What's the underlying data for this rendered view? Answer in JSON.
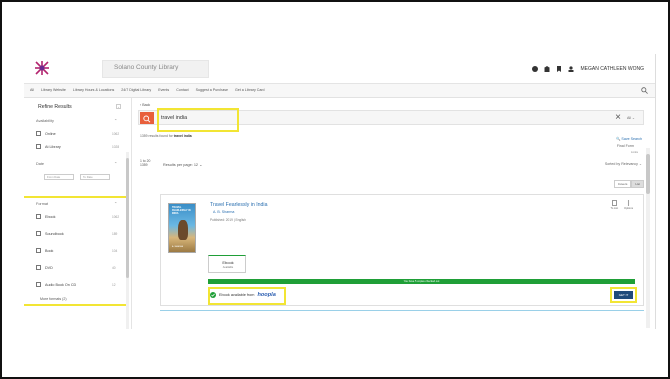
{
  "header": {
    "site_name": "Solano County Library",
    "user_name": "MEGAN CATHLEEN WONG"
  },
  "nav": {
    "items": [
      "All",
      "Library Website",
      "Library Hours & Locations",
      "24/7 Digital Library",
      "Events",
      "Contact",
      "Suggest a Purchase",
      "Get a Library Card"
    ]
  },
  "sidebar": {
    "title": "Refine Results",
    "availability": {
      "title": "Availability",
      "options": [
        {
          "label": "Online",
          "count": "1062"
        },
        {
          "label": "At Library",
          "count": "1028"
        }
      ]
    },
    "date": {
      "title": "Date",
      "from_placeholder": "From Date",
      "to_placeholder": "To Date"
    },
    "format": {
      "title": "Format",
      "options": [
        {
          "label": "Ebook",
          "count": "1062"
        },
        {
          "label": "Soundbook",
          "count": "189"
        },
        {
          "label": "Book",
          "count": "104"
        },
        {
          "label": "DVD",
          "count": "40"
        },
        {
          "label": "Audio Book On CD",
          "count": "12"
        }
      ],
      "more_label": "More formats (2)"
    }
  },
  "main": {
    "back_label": "Back",
    "search": {
      "value": "travel india",
      "scope": "All"
    },
    "results_prefix": "1359 results found for",
    "results_query": "travel india",
    "save_search": "Save Search",
    "final_results_label": "Final Form",
    "final_results_sub": "Links",
    "count_label": "1 to 20",
    "count_total": "1359",
    "per_page_label": "Results per page: 12",
    "sorted_label": "Sorted by Relevancy",
    "view_buttons": [
      "Covers",
      "List"
    ]
  },
  "result": {
    "cover_title": "TRAVEL FEARLESSLY IN INDIA",
    "cover_sub": "A. SHARMA",
    "title": "Travel Fearlessly in India",
    "author": "A. B. Sharma",
    "pub_info": "Published: 2019 | English",
    "action_add": "To List",
    "action_options": "Options",
    "format_name": "Ebook",
    "format_sub": "Available",
    "green_bar_text": "You have 5 copies checked out",
    "availability_text": "Ebook available from",
    "provider": "hoopla",
    "get_it_label": "GET IT",
    "more_info": "More Info about this edition"
  }
}
